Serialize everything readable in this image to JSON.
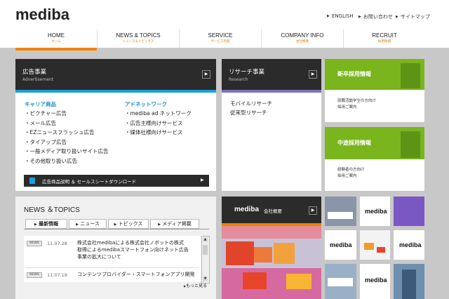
{
  "header": {
    "logo": "mediba",
    "links": [
      "ENGLISH",
      "お問い合わせ",
      "サイトマップ"
    ]
  },
  "nav": [
    {
      "en": "HOME",
      "ja": "ホーム",
      "active": true
    },
    {
      "en": "NEWS & TOPICS",
      "ja": "ニュース＆トピックス"
    },
    {
      "en": "SERVICE",
      "ja": "サービス内容"
    },
    {
      "en": "COMPANY INFO",
      "ja": "会社概要"
    },
    {
      "en": "RECRUIT",
      "ja": "採用情報"
    }
  ],
  "ad": {
    "title": "広告事業",
    "subtitle": "Advertisement",
    "col1_title": "キャリア商品",
    "col1_items": [
      "・ピクチャー広告",
      "・メール広告",
      "・EZニュースフラッシュ広告",
      "・タイアップ広告",
      "・一般メディア取り扱いサイト広告",
      "・その他取り扱い広告"
    ],
    "col2_title": "アドネットワーク",
    "col2_items": [
      "・mediba ad ネットワーク",
      "・広告主様向けサービス",
      "・媒体社様向けサービス"
    ],
    "download": "広告商品説明 ＆ セールスシートダウンロード"
  },
  "research": {
    "title": "リサーチ事業",
    "subtitle": "Research",
    "items": [
      "モバイルリサーチ",
      "従来型リサーチ"
    ]
  },
  "recruit_new": {
    "title": "新卒採用情報",
    "lines": [
      "就職活動学生の方向け",
      "採用ご案内"
    ]
  },
  "recruit_mid": {
    "title": "中途採用情報",
    "lines": [
      "経験者の方向け",
      "採用ご案内"
    ]
  },
  "news": {
    "title": "NEWS ＆TOPICS",
    "tabs": [
      "最新情報",
      "ニュース",
      "トピックス",
      "メディア掲載"
    ],
    "items": [
      {
        "badge": "NEWS",
        "date": "11.07.28",
        "text": "株式会社medibaによる株式会社ノボットの株式\n取得によるmedibaスマートフォン向けネット広告\n事業の拡大について"
      },
      {
        "badge": "NEWS",
        "date": "11.07.19",
        "text": "コンテンツプロバイダー・スマートフォンアプリ開発"
      }
    ],
    "more": "もっと見る"
  },
  "company": {
    "logo": "mediba",
    "label": "会社概要",
    "thumb_logo": "mediba"
  },
  "colors": {
    "accent": "#f08300",
    "blue": "#1aa0d8",
    "purple": "#7f72c0",
    "green": "#7ab51d"
  }
}
